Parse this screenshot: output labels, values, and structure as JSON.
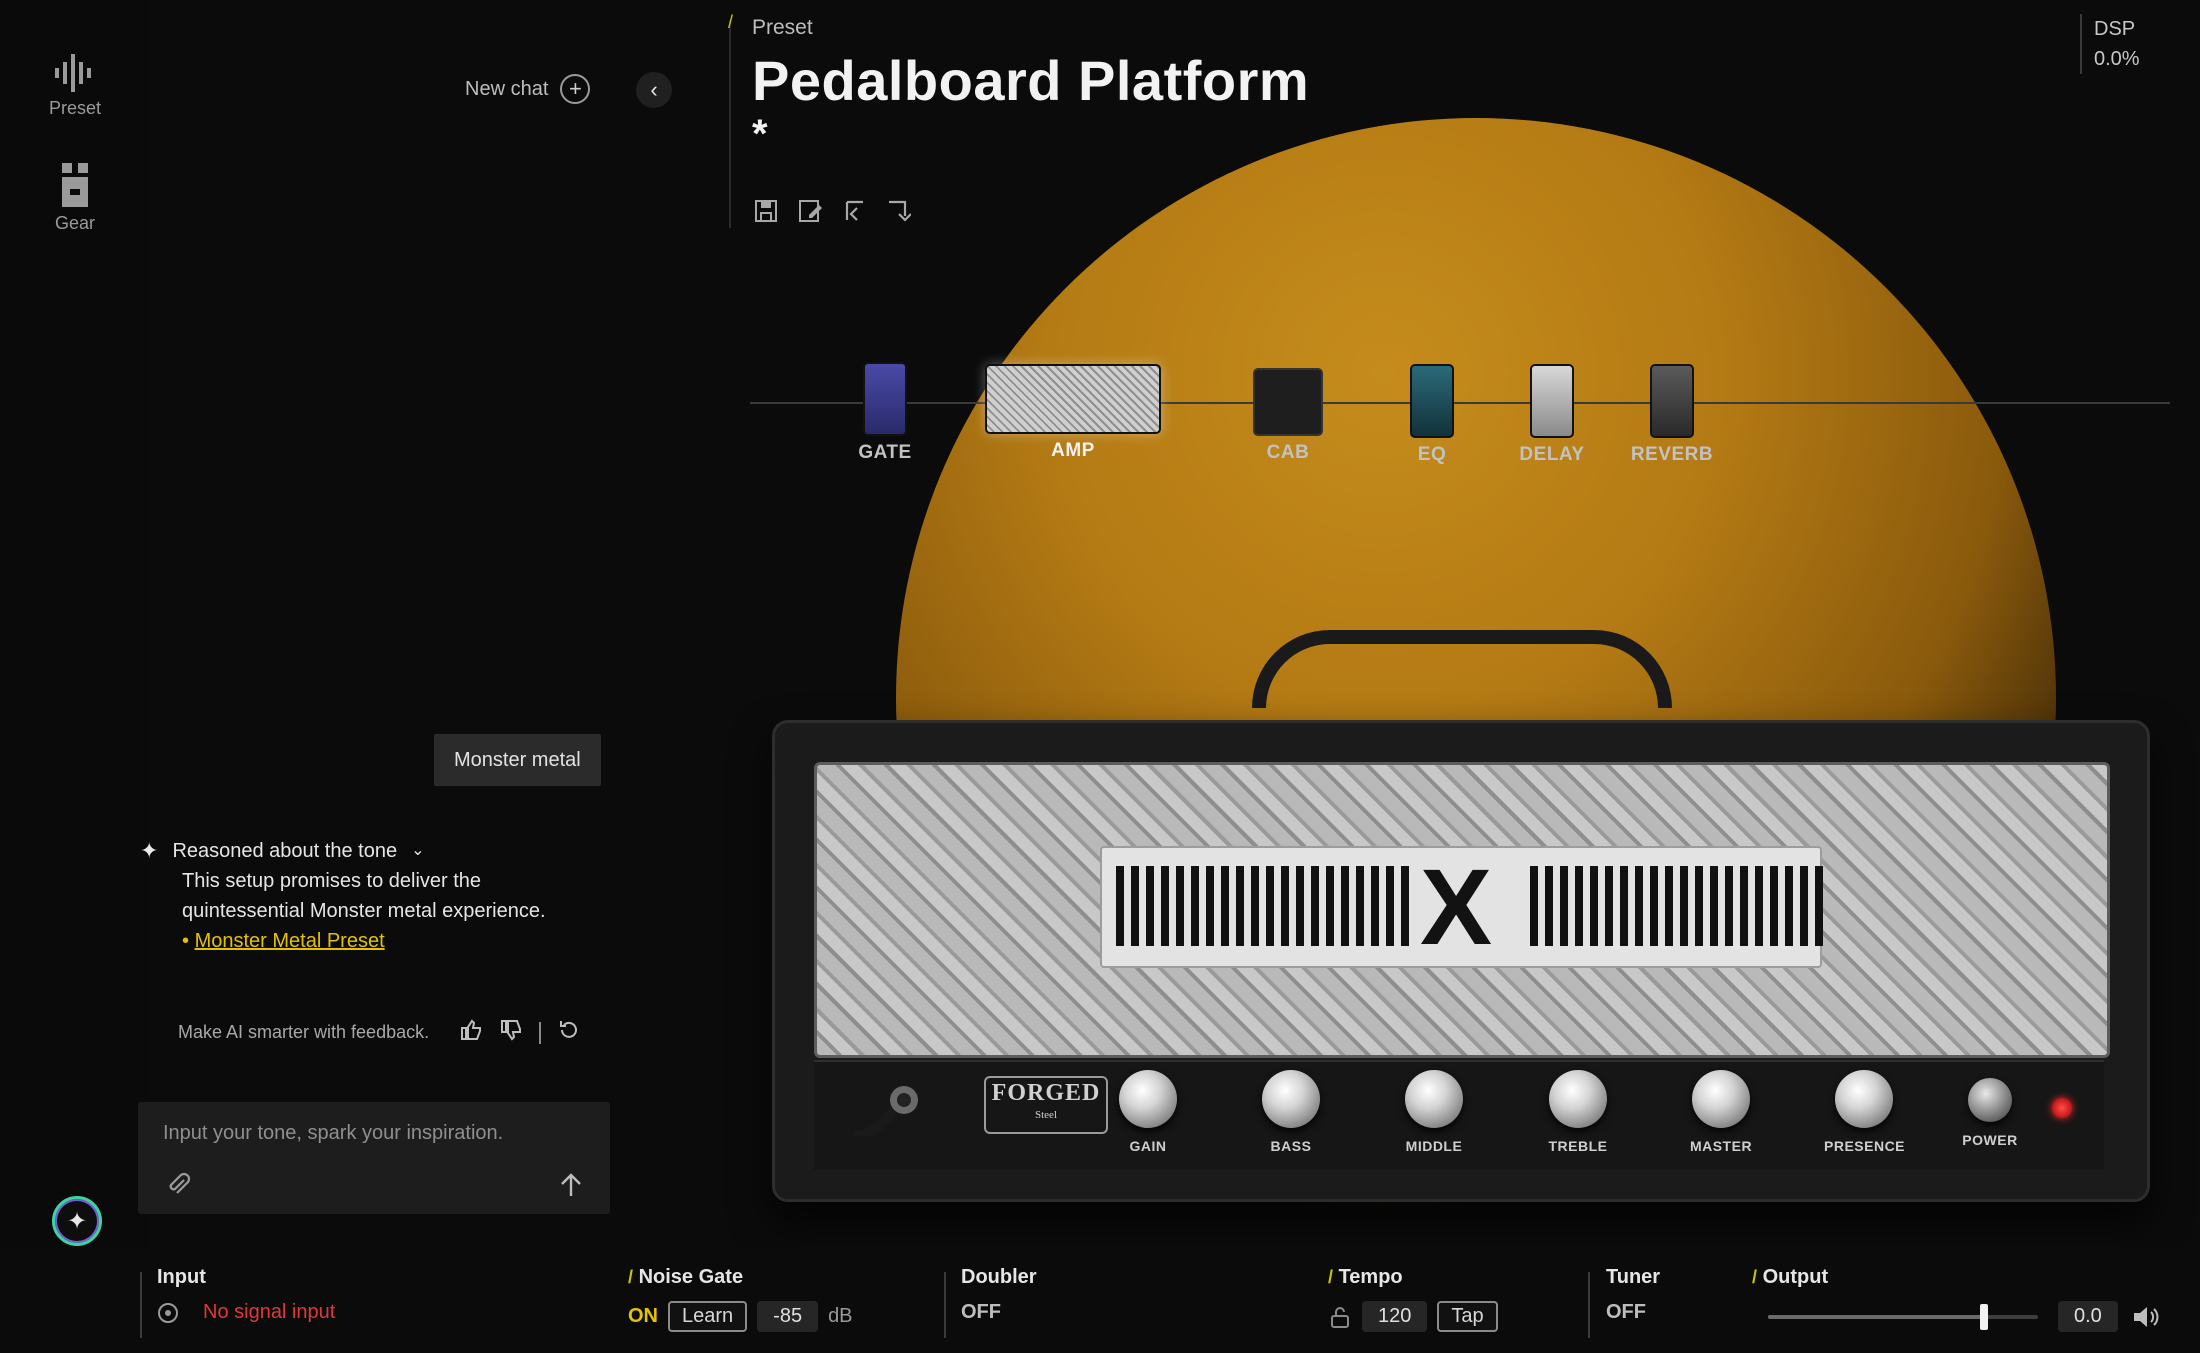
{
  "sidebar": {
    "items": [
      {
        "label": "Preset",
        "icon": "waveform-icon"
      },
      {
        "label": "Gear",
        "icon": "gear-stack-icon"
      }
    ]
  },
  "chat": {
    "new_chat_label": "New chat",
    "user_message": "Monster metal",
    "ai_reasoning_label": "Reasoned about the tone",
    "ai_response": "This setup promises to deliver the quintessential Monster metal experience.",
    "ai_link": "Monster Metal Preset",
    "feedback_prompt": "Make AI smarter with feedback.",
    "input_placeholder": "Input your tone, spark your inspiration."
  },
  "preset": {
    "section_label": "Preset",
    "title": "Pedalboard Platform",
    "modified_marker": "*"
  },
  "dsp": {
    "label": "DSP",
    "value": "0.0%"
  },
  "chain": [
    {
      "label": "GATE"
    },
    {
      "label": "AMP"
    },
    {
      "label": "CAB"
    },
    {
      "label": "EQ"
    },
    {
      "label": "DELAY"
    },
    {
      "label": "REVERB"
    }
  ],
  "amp": {
    "brand_main": "FORGED",
    "brand_sub": "Steel",
    "knobs": [
      "GAIN",
      "BASS",
      "MIDDLE",
      "TREBLE",
      "MASTER",
      "PRESENCE"
    ],
    "power_label": "POWER"
  },
  "bottom": {
    "input": {
      "title": "Input",
      "status": "No signal input"
    },
    "noise_gate": {
      "title": "Noise Gate",
      "state": "ON",
      "learn_label": "Learn",
      "threshold": "-85",
      "unit": "dB"
    },
    "doubler": {
      "title": "Doubler",
      "state": "OFF"
    },
    "tempo": {
      "title": "Tempo",
      "bpm": "120",
      "tap_label": "Tap"
    },
    "tuner": {
      "title": "Tuner",
      "state": "OFF"
    },
    "output": {
      "title": "Output",
      "value": "0.0",
      "level_fraction": 0.8
    }
  },
  "colors": {
    "accent": "#e6c200",
    "glow": "#c58c1c",
    "alert": "#e03838"
  }
}
